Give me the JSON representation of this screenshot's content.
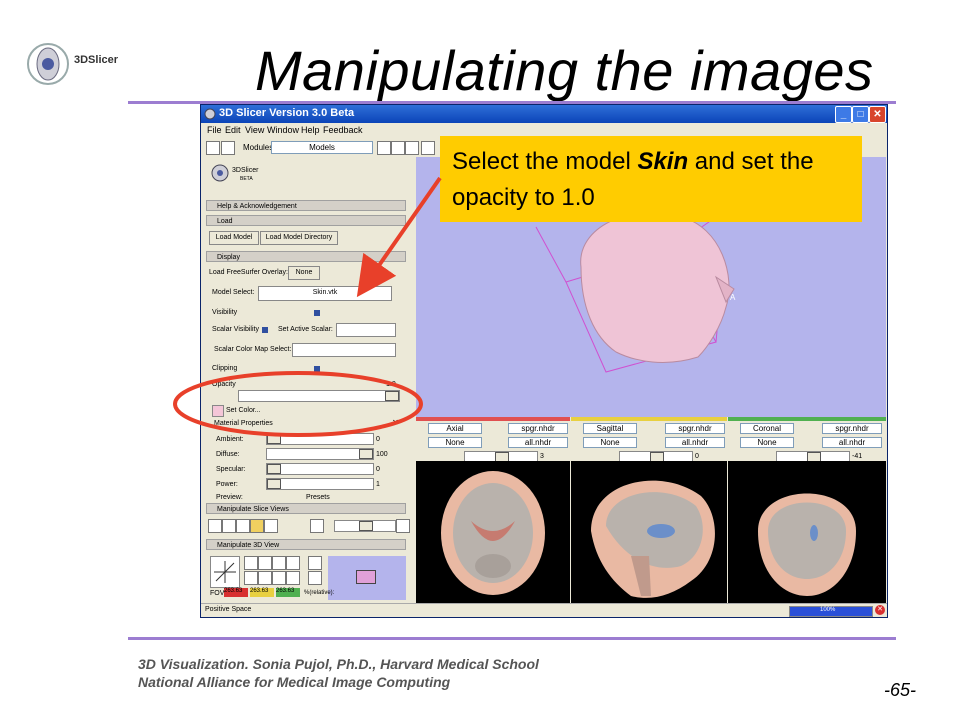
{
  "slide": {
    "title": "Manipulating the images",
    "logo_text": "3DSlicer",
    "footer_line1": "3D Visualization. Sonia Pujol, Ph.D., Harvard Medical School",
    "footer_line2": "National Alliance for Medical Image Computing",
    "page_number": "-65-"
  },
  "callout": {
    "pre": "Select the model ",
    "bold": "Skin",
    "post": " and set the opacity to 1.0"
  },
  "app": {
    "title": "3D Slicer Version 3.0 Beta",
    "menu": [
      "File",
      "Edit",
      "View",
      "Window",
      "Help",
      "Feedback"
    ],
    "modules_label": "Modules:",
    "modules_value": "Models",
    "logo_text": "3DSlicer",
    "logo_sub": "BETA",
    "sections": {
      "help": "Help & Acknowledgement",
      "load": "Load",
      "display": "Display",
      "manip_slice": "Manipulate Slice Views",
      "manip_3d": "Manipulate 3D View"
    },
    "load": {
      "load_model": "Load Model",
      "load_dir": "Load Model Directory"
    },
    "display": {
      "freesurfer_label": "Load FreeSurfer Overlay:",
      "freesurfer_btn": "None",
      "model_select_label": "Model Select:",
      "model_select_value": "Skin.vtk",
      "visibility_label": "Visibility",
      "scalar_visibility_label": "Scalar Visibility",
      "set_active_scalar_label": "Set Active Scalar:",
      "scalar_color_map_label": "Scalar Color Map Select:",
      "clipping_label": "Clipping",
      "opacity_label": "Opacity",
      "opacity_value": "1.0",
      "opacity_fraction": 1.0,
      "set_color_label": "Set Color...",
      "material_label": "Material Properties",
      "ambient_label": "Ambient:",
      "ambient_value": "0",
      "diffuse_label": "Diffuse:",
      "diffuse_value": "100",
      "specular_label": "Specular:",
      "specular_value": "0",
      "power_label": "Power:",
      "power_value": "1",
      "preview_label": "Preview:",
      "presets_label": "Presets"
    },
    "fov": {
      "label": "FOV:",
      "v1": "263.63",
      "v2": "263.63",
      "v3": "263.63",
      "zoom_label": "%(relative):",
      "zoom_value": "100"
    },
    "slices": [
      {
        "name": "Axial",
        "fg": "spgr.nhdr",
        "bg": "None",
        "bg2": "all.nhdr",
        "offset": "3",
        "color": "#e05050"
      },
      {
        "name": "Sagittal",
        "fg": "spgr.nhdr",
        "bg": "None",
        "bg2": "all.nhdr",
        "offset": "0",
        "color": "#e8d040"
      },
      {
        "name": "Coronal",
        "fg": "spgr.nhdr",
        "bg": "None",
        "bg2": "all.nhdr",
        "offset": "-41",
        "color": "#50b050"
      }
    ],
    "view3d_label": "A",
    "status_text": "Positive Space",
    "progress_text": "100%",
    "progress_fraction": 1.0
  }
}
